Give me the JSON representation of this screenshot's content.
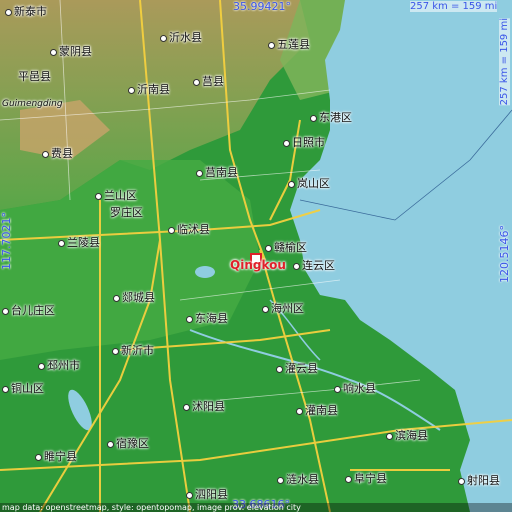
{
  "place": {
    "name": "Qingkou",
    "color": "#e0202a"
  },
  "coords": {
    "top": "35.99421°",
    "bottom": "33.68616°",
    "left": "117.7021°",
    "right": "120.5146°"
  },
  "scale": {
    "top": "257 km = 159 mi",
    "right": "257 km = 159 mi"
  },
  "attribution": "map data: openstreetmap, style: opentopomap, image prov. elevation city",
  "colors": {
    "sea": "#8fcde0",
    "land": "#2f9a3a",
    "hills": "#c8a86a",
    "roads": "#f4d03f",
    "text_accent": "#3a55e8"
  },
  "labels": [
    {
      "name": "label-xintai",
      "text": "新泰市"
    },
    {
      "name": "label-yishui",
      "text": "沂水县"
    },
    {
      "name": "label-wulian",
      "text": "五莲县"
    },
    {
      "name": "label-mengyin",
      "text": "蒙阴县"
    },
    {
      "name": "label-pingyi",
      "text": "平邑县"
    },
    {
      "name": "label-juxian",
      "text": "莒县"
    },
    {
      "name": "label-guimengding",
      "text": "Guimengding"
    },
    {
      "name": "label-yinan",
      "text": "沂南县"
    },
    {
      "name": "label-donggang",
      "text": "东港区"
    },
    {
      "name": "label-rizhao",
      "text": "日照市"
    },
    {
      "name": "label-feixian",
      "text": "费县"
    },
    {
      "name": "label-junan",
      "text": "莒南县"
    },
    {
      "name": "label-lanshan",
      "text": "岚山区"
    },
    {
      "name": "label-lanshan-linyi",
      "text": "兰山区"
    },
    {
      "name": "label-luozhuang",
      "text": "罗庄区"
    },
    {
      "name": "label-linshu",
      "text": "临沭县"
    },
    {
      "name": "label-ganyu",
      "text": "赣榆区"
    },
    {
      "name": "label-lanling",
      "text": "兰陵县"
    },
    {
      "name": "label-lianyun",
      "text": "连云区"
    },
    {
      "name": "label-tancheng",
      "text": "郯城县"
    },
    {
      "name": "label-taierzhuang",
      "text": "台儿庄区"
    },
    {
      "name": "label-donghai",
      "text": "东海县"
    },
    {
      "name": "label-haizhou",
      "text": "海州区"
    },
    {
      "name": "label-xinyi",
      "text": "新沂市"
    },
    {
      "name": "label-pizhou",
      "text": "邳州市"
    },
    {
      "name": "label-guanyun",
      "text": "灌云县"
    },
    {
      "name": "label-xiangshui",
      "text": "响水县"
    },
    {
      "name": "label-tongshan",
      "text": "铜山区"
    },
    {
      "name": "label-shuyang",
      "text": "沭阳县"
    },
    {
      "name": "label-guannan",
      "text": "灌南县"
    },
    {
      "name": "label-binhai",
      "text": "滨海县"
    },
    {
      "name": "label-suyu",
      "text": "宿豫区"
    },
    {
      "name": "label-suining",
      "text": "睢宁县"
    },
    {
      "name": "label-lianshui",
      "text": "涟水县"
    },
    {
      "name": "label-funing",
      "text": "阜宁县"
    },
    {
      "name": "label-sheyang",
      "text": "射阳县"
    },
    {
      "name": "label-siyang",
      "text": "泗阳县"
    }
  ]
}
